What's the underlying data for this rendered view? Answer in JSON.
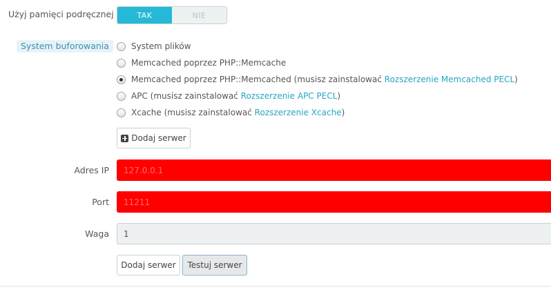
{
  "cache": {
    "use_cache_label": "Użyj pamięci podręcznej",
    "toggle": {
      "on_label": "TAK",
      "off_label": "NIE",
      "selected": "TAK"
    },
    "system_label": "System buforowania",
    "options": [
      {
        "text": "System plików",
        "link": "",
        "suffix": "",
        "checked": false
      },
      {
        "text": "Memcached poprzez PHP::Memcache",
        "link": "",
        "suffix": "",
        "checked": false
      },
      {
        "text": "Memcached poprzez PHP::Memcached (musisz zainstalować ",
        "link": "Rozszerzenie Memcached PECL",
        "suffix": ")",
        "checked": true
      },
      {
        "text": "APC (musisz zainstalować ",
        "link": "Rozszerzenie APC PECL",
        "suffix": ")",
        "checked": false
      },
      {
        "text": "Xcache (musisz zainstalować ",
        "link": "Rozszerzenie Xcache",
        "suffix": ")",
        "checked": false
      }
    ],
    "add_server_label": "Dodaj serwer"
  },
  "server_form": {
    "ip_label": "Adres IP",
    "ip_value": "127.0.0.1",
    "port_label": "Port",
    "port_value": "11211",
    "weight_label": "Waga",
    "weight_value": "1",
    "add_button": "Dodaj serwer",
    "test_button": "Testuj serwer"
  },
  "colors": {
    "accent": "#25b9d7",
    "error": "#ff0000",
    "link": "#25a5c7"
  }
}
